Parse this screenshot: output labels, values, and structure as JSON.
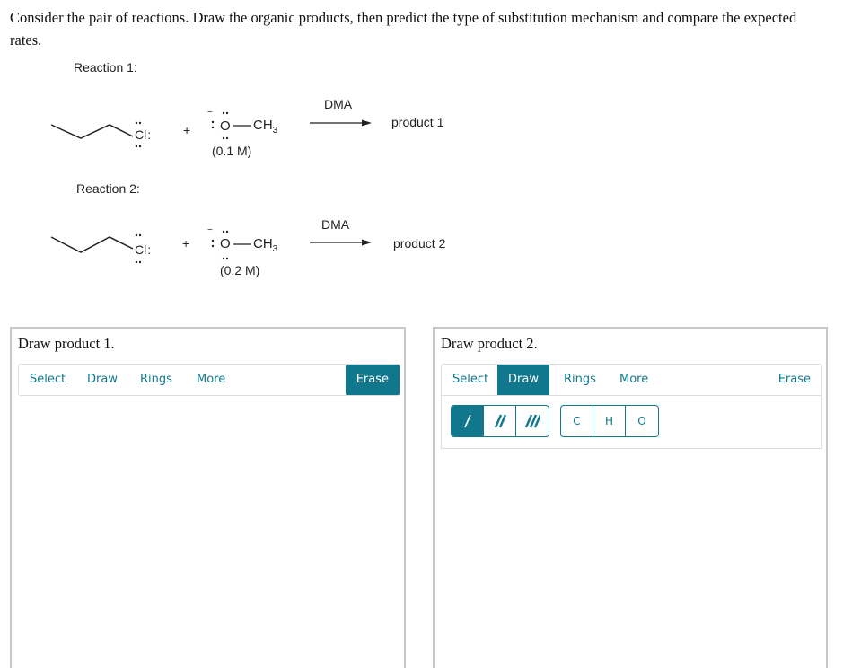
{
  "question": {
    "text": "Consider the pair of reactions. Draw the organic products, then predict the type of substitution mechanism and compare the expected rates."
  },
  "reactions": [
    {
      "label": "Reaction 1:",
      "substrate_leaving_group": "Cl",
      "plus": "+",
      "nucleophile_atom": "O",
      "nucleophile_group": "CH",
      "nucleophile_subscript": "3",
      "nucleophile_charge": "−",
      "concentration": "(0.1 M)",
      "solvent": "DMA",
      "product": "product 1"
    },
    {
      "label": "Reaction 2:",
      "substrate_leaving_group": "Cl",
      "plus": "+",
      "nucleophile_atom": "O",
      "nucleophile_group": "CH",
      "nucleophile_subscript": "3",
      "nucleophile_charge": "−",
      "concentration": "(0.2 M)",
      "solvent": "DMA",
      "product": "product 2"
    }
  ],
  "panels": [
    {
      "title": "Draw product 1.",
      "toolbar": {
        "select": "Select",
        "draw": "Draw",
        "rings": "Rings",
        "more": "More",
        "erase": "Erase",
        "active": "Erase"
      }
    },
    {
      "title": "Draw product 2.",
      "toolbar": {
        "select": "Select",
        "draw": "Draw",
        "rings": "Rings",
        "more": "More",
        "erase": "Erase",
        "active": "Draw"
      },
      "bond_tools": [
        {
          "name": "single-bond",
          "icon": "single-bond-icon",
          "active": true
        },
        {
          "name": "double-bond",
          "icon": "double-bond-icon",
          "active": false
        },
        {
          "name": "triple-bond",
          "icon": "triple-bond-icon",
          "active": false
        }
      ],
      "atom_tools": [
        "C",
        "H",
        "O"
      ]
    }
  ],
  "colors": {
    "accent": "#10778d",
    "border": "#c8c8c8"
  }
}
